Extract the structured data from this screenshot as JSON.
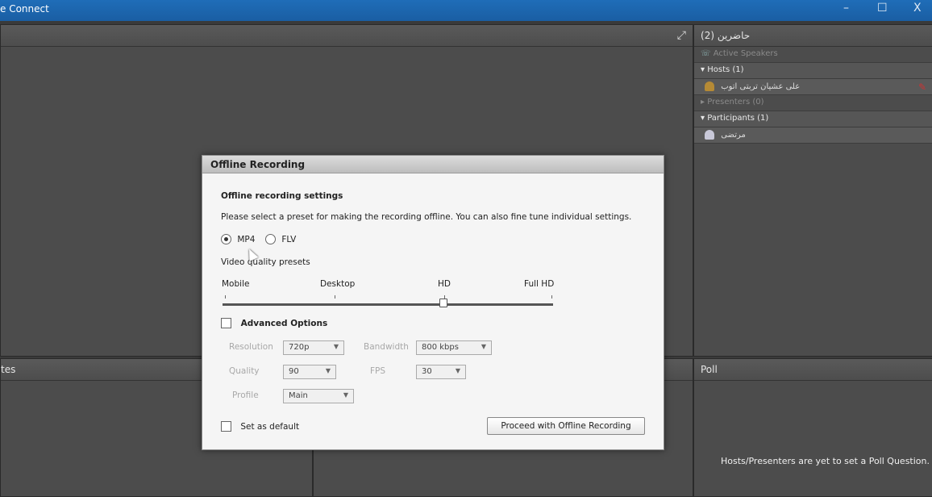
{
  "window": {
    "title": "e Connect",
    "controls": [
      "–",
      "☐",
      "X"
    ]
  },
  "video_pod": {
    "fullscreen_icon": "fullscreen-icon"
  },
  "attendee_pod": {
    "header": "حاضرین (2)",
    "active_speakers": "Active Speakers",
    "hosts": "Hosts (1)",
    "host_name": "علی عشیان تربتی اتوب",
    "presenters": "Presenters (0)",
    "participants": "Participants (1)",
    "participant_name": "مرتضی"
  },
  "notes_pod": {
    "header": "tes"
  },
  "poll_pod": {
    "header": "Poll",
    "message": "Hosts/Presenters are yet to set a Poll Question."
  },
  "dialog": {
    "title": "Offline Recording",
    "settings_heading": "Offline recording settings",
    "instruction": "Please select a preset for making the recording offline. You can also fine tune individual settings.",
    "format_mp4": "MP4",
    "format_flv": "FLV",
    "selected_format": "MP4",
    "quality_label": "Video quality presets",
    "presets": [
      "Mobile",
      "Desktop",
      "HD",
      "Full HD"
    ],
    "selected_preset": "HD",
    "advanced_label": "Advanced Options",
    "resolution_label": "Resolution",
    "resolution_value": "720p",
    "bandwidth_label": "Bandwidth",
    "bandwidth_value": "800 kbps",
    "quality_field_label": "Quality",
    "quality_value": "90",
    "fps_label": "FPS",
    "fps_value": "30",
    "profile_label": "Profile",
    "profile_value": "Main",
    "default_label": "Set as default",
    "proceed_label": "Proceed with Offline Recording"
  }
}
